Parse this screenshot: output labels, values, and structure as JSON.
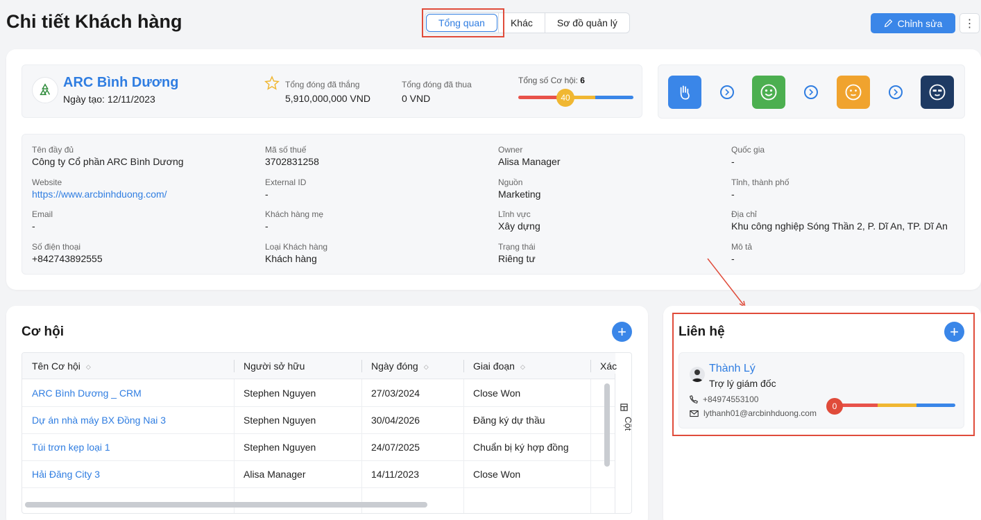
{
  "page": {
    "title": "Chi tiết Khách hàng"
  },
  "tabs": [
    {
      "label": "Tổng quan",
      "active": true
    },
    {
      "label": "Khác",
      "active": false
    },
    {
      "label": "Sơ đồ quản lý",
      "active": false
    }
  ],
  "toolbar": {
    "edit_label": "Chỉnh sửa",
    "more_label": "⋮"
  },
  "customer": {
    "name": "ARC Bình Dương",
    "created": "Ngày tạo: 12/11/2023",
    "won_label": "Tổng đóng đã thắng",
    "won_value": "5,910,000,000 VND",
    "lost_label": "Tổng đóng đã thua",
    "lost_value": "0 VND",
    "opp_count_label": "Tổng số Cơ hội:",
    "opp_count": "6",
    "score": "40",
    "score_colors": [
      "#e8524a",
      "#f0b732",
      "#3a86e8"
    ]
  },
  "stages": [
    {
      "icon": "hand-wave-icon",
      "color": "#3a86e8"
    },
    {
      "icon": "smile-face-icon",
      "color": "#4caf50"
    },
    {
      "icon": "neutral-face-icon",
      "color": "#f0a32e"
    },
    {
      "icon": "cool-face-icon",
      "color": "#1e3a63"
    }
  ],
  "details": {
    "full_name": {
      "label": "Tên đầy đủ",
      "value": "Công ty Cổ phần ARC Bình Dương"
    },
    "tax_code": {
      "label": "Mã số thuế",
      "value": "3702831258"
    },
    "owner": {
      "label": "Owner",
      "value": "Alisa Manager"
    },
    "country": {
      "label": "Quốc gia",
      "value": "-"
    },
    "website": {
      "label": "Website",
      "value": "https://www.arcbinhduong.com/"
    },
    "external_id": {
      "label": "External ID",
      "value": "-"
    },
    "source": {
      "label": "Nguồn",
      "value": "Marketing"
    },
    "province": {
      "label": "Tỉnh, thành phố",
      "value": "-"
    },
    "email": {
      "label": "Email",
      "value": "-"
    },
    "parent": {
      "label": "Khách hàng mẹ",
      "value": "-"
    },
    "industry": {
      "label": "Lĩnh vực",
      "value": "Xây dựng"
    },
    "address": {
      "label": "Địa chỉ",
      "value": "Khu công nghiệp Sóng Thần 2, P. Dĩ An, TP. Dĩ An"
    },
    "phone": {
      "label": "Số điện thoại",
      "value": "+842743892555"
    },
    "customer_type": {
      "label": "Loại Khách hàng",
      "value": "Khách hàng"
    },
    "status": {
      "label": "Trạng thái",
      "value": "Riêng tư"
    },
    "description": {
      "label": "Mô tả",
      "value": "-"
    }
  },
  "opportunities": {
    "title": "Cơ hội",
    "add_label": "+",
    "columns": [
      "Tên Cơ hội",
      "Người sở hữu",
      "Ngày đóng",
      "Giai đoạn",
      "Xác"
    ],
    "rows": [
      {
        "name": "ARC Bình Dương _ CRM",
        "owner": "Stephen Nguyen",
        "close_date": "27/03/2024",
        "stage": "Close Won"
      },
      {
        "name": "Dự án nhà máy BX Đồng Nai 3",
        "owner": "Stephen Nguyen",
        "close_date": "30/04/2026",
        "stage": "Đăng ký dự thầu"
      },
      {
        "name": "Túi trơn kẹp loại 1",
        "owner": "Stephen Nguyen",
        "close_date": "24/07/2025",
        "stage": "Chuẩn bị ký hợp đồng"
      },
      {
        "name": "Hải Đăng City 3",
        "owner": "Alisa Manager",
        "close_date": "14/11/2023",
        "stage": "Close Won"
      }
    ],
    "columns_panel_label": "Cột"
  },
  "contacts": {
    "title": "Liên hệ",
    "add_label": "+",
    "items": [
      {
        "name": "Thành Lý",
        "role": "Trợ lý giám đốc",
        "phone": "+84974553100",
        "email": "lythanh01@arcbinhduong.com",
        "score": "0"
      }
    ]
  }
}
